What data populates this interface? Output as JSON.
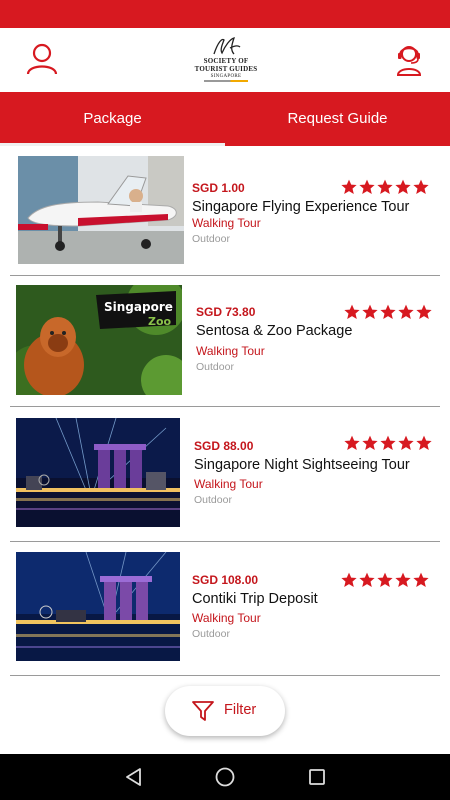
{
  "colors": {
    "brand": "#d71920",
    "price": "#c4161c",
    "muted": "#9a9a9a"
  },
  "header": {
    "logo": {
      "line1": "SOCIETY OF",
      "line2": "TOURIST GUIDES",
      "line3": "SINGAPORE"
    },
    "left_icon": "user-icon",
    "right_icon": "support-agent-icon"
  },
  "tabs": [
    {
      "label": "Package",
      "active": true
    },
    {
      "label": "Request Guide",
      "active": false
    }
  ],
  "packages": [
    {
      "price": "SGD 1.00",
      "title": "Singapore Flying Experience Tour",
      "category": "Walking Tour",
      "setting": "Outdoor",
      "rating": 5
    },
    {
      "price": "SGD 73.80",
      "title": "Sentosa & Zoo Package",
      "category": "Walking Tour",
      "setting": "Outdoor",
      "rating": 5
    },
    {
      "price": "SGD 88.00",
      "title": "Singapore Night Sightseeing Tour",
      "category": "Walking Tour",
      "setting": "Outdoor",
      "rating": 5
    },
    {
      "price": "SGD 108.00",
      "title": "Contiki Trip Deposit",
      "category": "Walking Tour",
      "setting": "Outdoor",
      "rating": 5
    }
  ],
  "thumb_text": {
    "sign_line1": "Singapore",
    "sign_line2": "Zoo"
  },
  "filter": {
    "label": "Filter",
    "icon": "funnel-icon"
  },
  "navbar": {
    "back_icon": "back-triangle-icon",
    "home_icon": "home-circle-icon",
    "recent_icon": "recents-square-icon"
  }
}
